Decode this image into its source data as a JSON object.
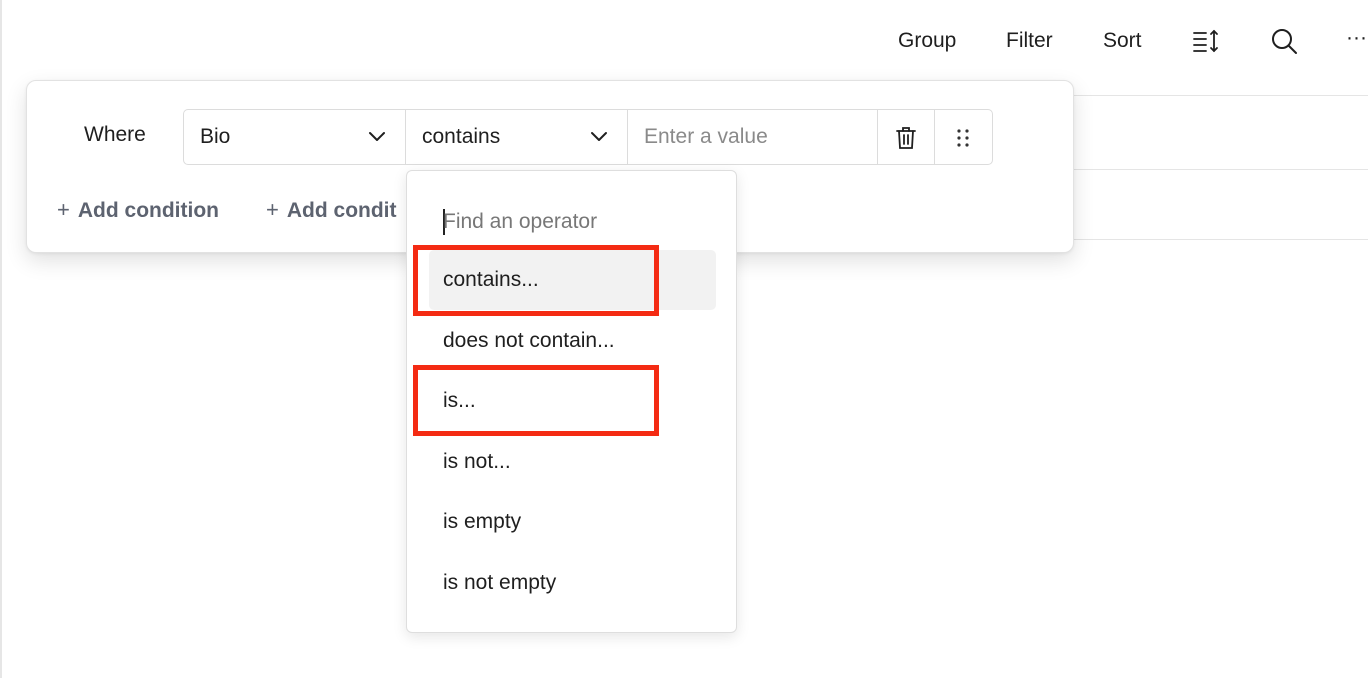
{
  "toolbar": {
    "group_label": "Group",
    "filter_label": "Filter",
    "sort_label": "Sort",
    "row_height_icon": "row-height-icon",
    "search_icon": "search-icon",
    "more_icon": "more-icon",
    "more_label": "···"
  },
  "filter": {
    "where_label": "Where",
    "field_value": "Bio",
    "operator_value": "contains",
    "value_placeholder": "Enter a value",
    "add_condition_label": "Add condition",
    "add_condition_group_label": "Add condit"
  },
  "operator_dropdown": {
    "search_placeholder": "Find an operator",
    "items": [
      {
        "label": "contains..."
      },
      {
        "label": "does not contain..."
      },
      {
        "label": "is..."
      },
      {
        "label": "is not..."
      },
      {
        "label": "is empty"
      },
      {
        "label": "is not empty"
      }
    ],
    "selected": "contains..."
  },
  "colors": {
    "highlight": "#f42b13",
    "add_condition_text": "#5d6370",
    "selected_item_bg": "#f2f2f2"
  }
}
